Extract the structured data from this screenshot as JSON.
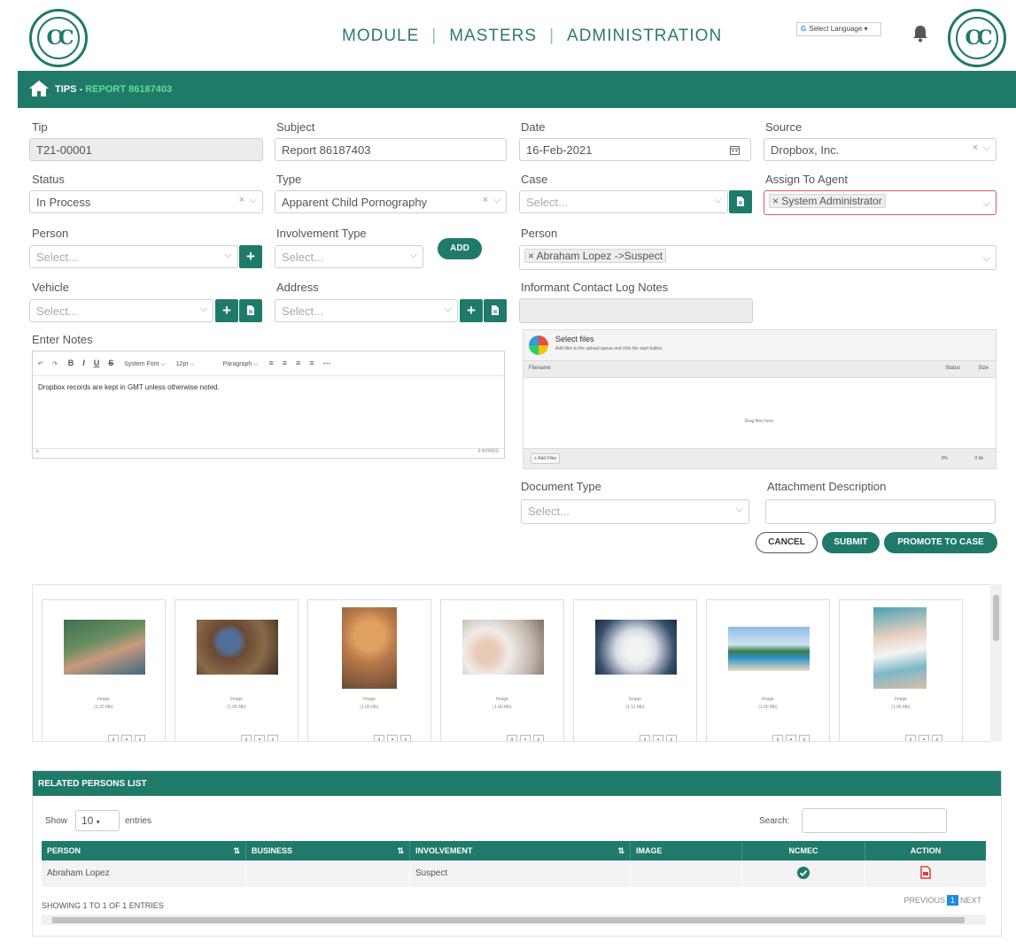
{
  "header": {
    "logo_text": "CC",
    "nav": [
      "MODULE",
      "MASTERS",
      "ADMINISTRATION"
    ],
    "language_label": "Select Language",
    "language_google_mark": "G"
  },
  "breadcrumb": {
    "section": "TIPS - ",
    "current": "REPORT 86187403"
  },
  "form": {
    "tip": {
      "label": "Tip",
      "value": "T21-00001"
    },
    "subject": {
      "label": "Subject",
      "value": "Report 86187403"
    },
    "date": {
      "label": "Date",
      "value": "16-Feb-2021"
    },
    "source": {
      "label": "Source",
      "value": "Dropbox, Inc."
    },
    "status": {
      "label": "Status",
      "value": "In Process"
    },
    "type": {
      "label": "Type",
      "value": "Apparent Child Pornography"
    },
    "case": {
      "label": "Case",
      "placeholder": "Select..."
    },
    "assign_agent": {
      "label": "Assign To Agent",
      "value": "× System Administrator"
    },
    "person1": {
      "label": "Person",
      "placeholder": "Select..."
    },
    "involvement": {
      "label": "Involvement Type",
      "placeholder": "Select..."
    },
    "add_label": "ADD",
    "person2": {
      "label": "Person",
      "value": "× Abraham Lopez ->Suspect"
    },
    "vehicle": {
      "label": "Vehicle",
      "placeholder": "Select..."
    },
    "address": {
      "label": "Address",
      "placeholder": "Select..."
    },
    "informant": {
      "label": "Informant Contact Log Notes",
      "value": ""
    },
    "notes": {
      "label": "Enter Notes",
      "toolbar": {
        "font": "System Font",
        "size": "12pt",
        "block": "Paragraph"
      },
      "text": "Dropbox records are kept in GMT unless otherwise noted.",
      "footer_left": "p",
      "footer_right": "9 WORDS"
    },
    "document_type": {
      "label": "Document Type",
      "placeholder": "Select..."
    },
    "attachment_desc": {
      "label": "Attachment Description",
      "value": ""
    },
    "cancel": "CANCEL",
    "submit": "SUBMIT",
    "promote": "PROMOTE TO CASE"
  },
  "uploader": {
    "title": "Select files",
    "subtitle": "Add files to the upload queue and click the start button.",
    "col_filename": "Filename",
    "col_status": "Status",
    "col_size": "Size",
    "drop_text": "Drag files here.",
    "add_files": "Add Files",
    "total_status": "0%",
    "total_size": "0 kb"
  },
  "gallery": [
    {
      "type": "Image",
      "size": "(1.20 Mb)"
    },
    {
      "type": "Image",
      "size": "(1.05 Mb)"
    },
    {
      "type": "Image",
      "size": "(1.00 Mb)"
    },
    {
      "type": "Image",
      "size": "(1.00 Mb)"
    },
    {
      "type": "Image",
      "size": "(1.11 Mb)"
    },
    {
      "type": "Image",
      "size": "(1.00 Mb)"
    },
    {
      "type": "Image",
      "size": "(1.06 Mb)"
    }
  ],
  "related": {
    "title": "RELATED PERSONS LIST",
    "show": "Show",
    "entries_count": "10",
    "entries": "entries",
    "search": "Search:",
    "columns": [
      "PERSON",
      "BUSINESS",
      "INVOLVEMENT",
      "IMAGE",
      "NCMEC",
      "ACTION"
    ],
    "rows": [
      {
        "person": "Abraham Lopez",
        "business": "",
        "involvement": "Suspect",
        "image": ""
      }
    ],
    "showing": "SHOWING 1 TO 1 OF 1 ENTRIES",
    "previous": "PREVIOUS",
    "page": "1",
    "next": "NEXT"
  },
  "colors": {
    "brand": "#1f7a6a",
    "accent": "#5fe08f",
    "pager": "#1e8ae6",
    "pdf": "#e53935"
  }
}
